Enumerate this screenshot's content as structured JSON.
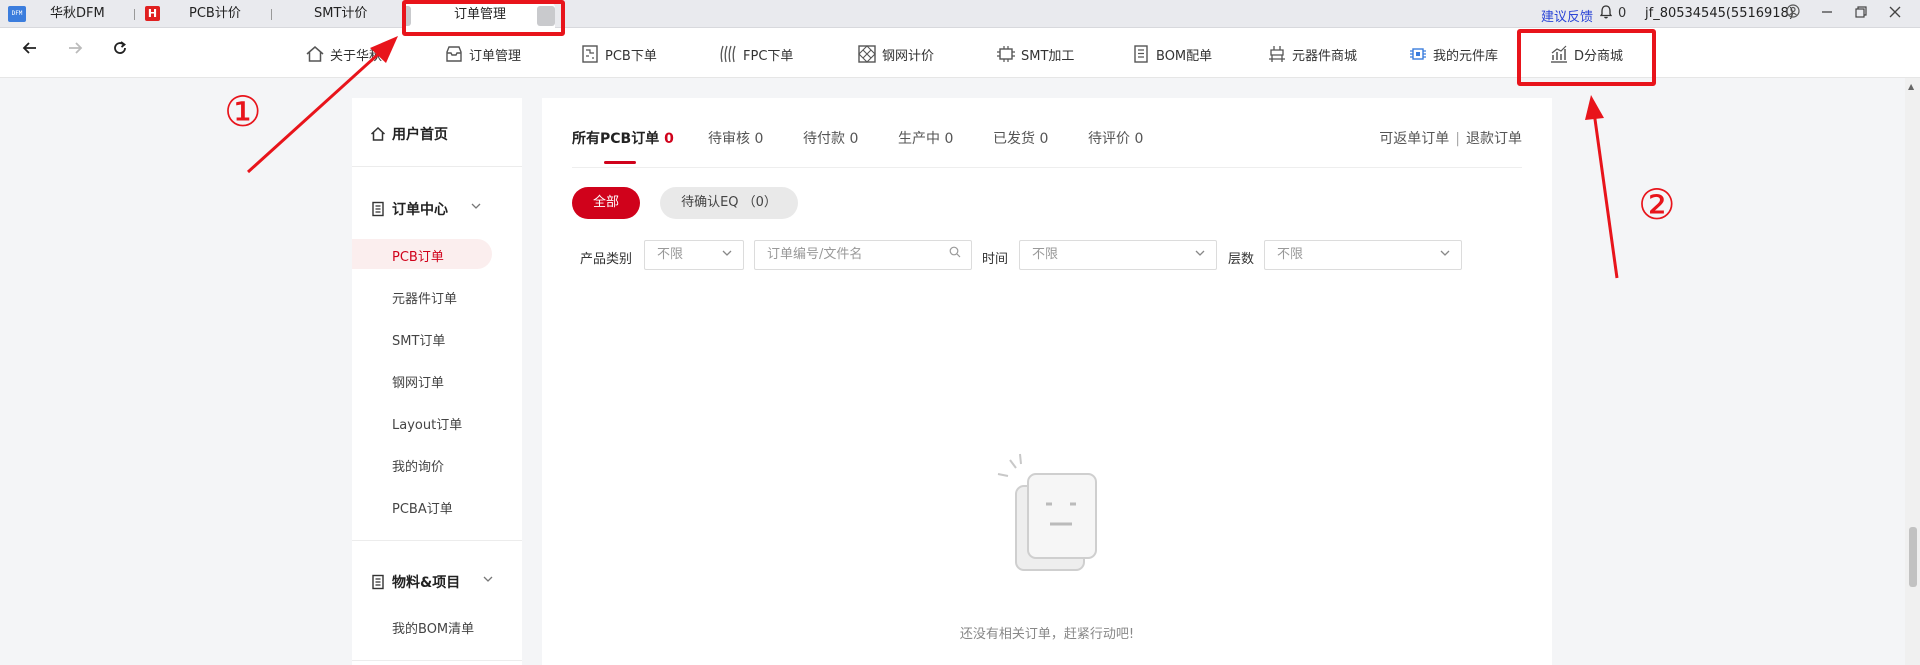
{
  "titlebar": {
    "app_logo": "DFM",
    "tabs": [
      {
        "label": "华秋DFM"
      },
      {
        "label": "PCB计价"
      },
      {
        "label": "SMT计价"
      }
    ],
    "active_tab": "订单管理",
    "h_badge": "H",
    "feedback": "建议反馈",
    "notification_count": "0",
    "user_id": "jf_80534545(5516918)"
  },
  "nav": {
    "back_icon": "arrow-left-icon",
    "forward_icon": "arrow-right-icon",
    "refresh_icon": "refresh-icon",
    "items": [
      {
        "label": "关于华秋",
        "icon": "home-icon"
      },
      {
        "label": "订单管理",
        "icon": "inbox-icon"
      },
      {
        "label": "PCB下单",
        "icon": "pcb-icon"
      },
      {
        "label": "FPC下单",
        "icon": "fpc-icon"
      },
      {
        "label": "钢网计价",
        "icon": "stencil-icon"
      },
      {
        "label": "SMT加工",
        "icon": "chip-icon"
      },
      {
        "label": "BOM配单",
        "icon": "list-icon"
      },
      {
        "label": "元器件商城",
        "icon": "component-icon"
      },
      {
        "label": "我的元件库",
        "icon": "library-icon"
      },
      {
        "label": "D分商城",
        "icon": "chart-icon"
      }
    ]
  },
  "sidebar": {
    "home": "用户首页",
    "order_center": "订单中心",
    "order_items": [
      "PCB订单",
      "元器件订单",
      "SMT订单",
      "钢网订单",
      "Layout订单",
      "我的询价",
      "PCBA订单"
    ],
    "materials": "物料&项目",
    "material_items": [
      "我的BOM清单"
    ]
  },
  "main": {
    "tabs": [
      {
        "label": "所有PCB订单",
        "count": "0"
      },
      {
        "label": "待审核",
        "count": "0"
      },
      {
        "label": "待付款",
        "count": "0"
      },
      {
        "label": "生产中",
        "count": "0"
      },
      {
        "label": "已发货",
        "count": "0"
      },
      {
        "label": "待评价",
        "count": "0"
      }
    ],
    "right_links": [
      "可返单订单",
      "退款订单"
    ],
    "pill_all": "全部",
    "pill_eq": "待确认EQ （0）",
    "filters": {
      "product_label": "产品类别",
      "product_value": "不限",
      "search_placeholder": "订单编号/文件名",
      "time_label": "时间",
      "time_value": "不限",
      "layers_label": "层数",
      "layers_value": "不限"
    },
    "empty_text": "还没有相关订单，赶紧行动吧!"
  },
  "annotations": {
    "num1": "①",
    "num2": "②",
    "color": "#e8141b"
  }
}
